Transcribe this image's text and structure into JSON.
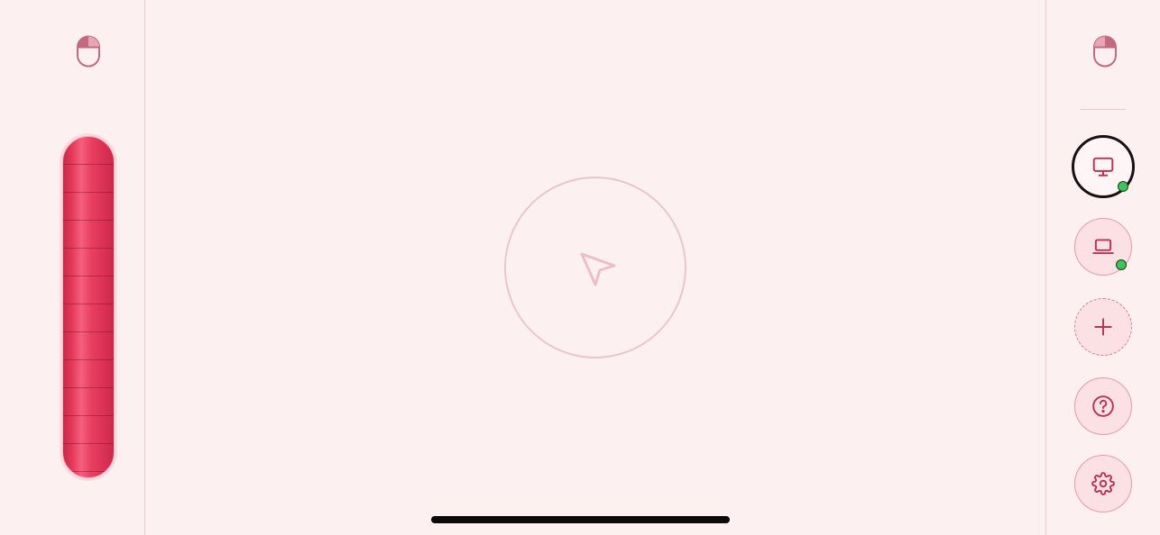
{
  "colors": {
    "background": "#fdf0f1",
    "accent": "#e5385a",
    "icon": "#b8344f",
    "online": "#3dc45a"
  },
  "left_panel": {
    "mouse_icon": "mouse-icon",
    "scroll_wheel_icon": "scroll-wheel"
  },
  "trackpad": {
    "icon": "cursor-arrow-icon"
  },
  "right_panel": {
    "mouse_icon": "mouse-icon",
    "devices": [
      {
        "icon": "monitor-icon",
        "active": true,
        "online": true
      },
      {
        "icon": "laptop-icon",
        "active": false,
        "online": true
      }
    ],
    "actions": [
      {
        "icon": "plus-icon"
      },
      {
        "icon": "help-icon"
      },
      {
        "icon": "gear-icon"
      }
    ]
  }
}
